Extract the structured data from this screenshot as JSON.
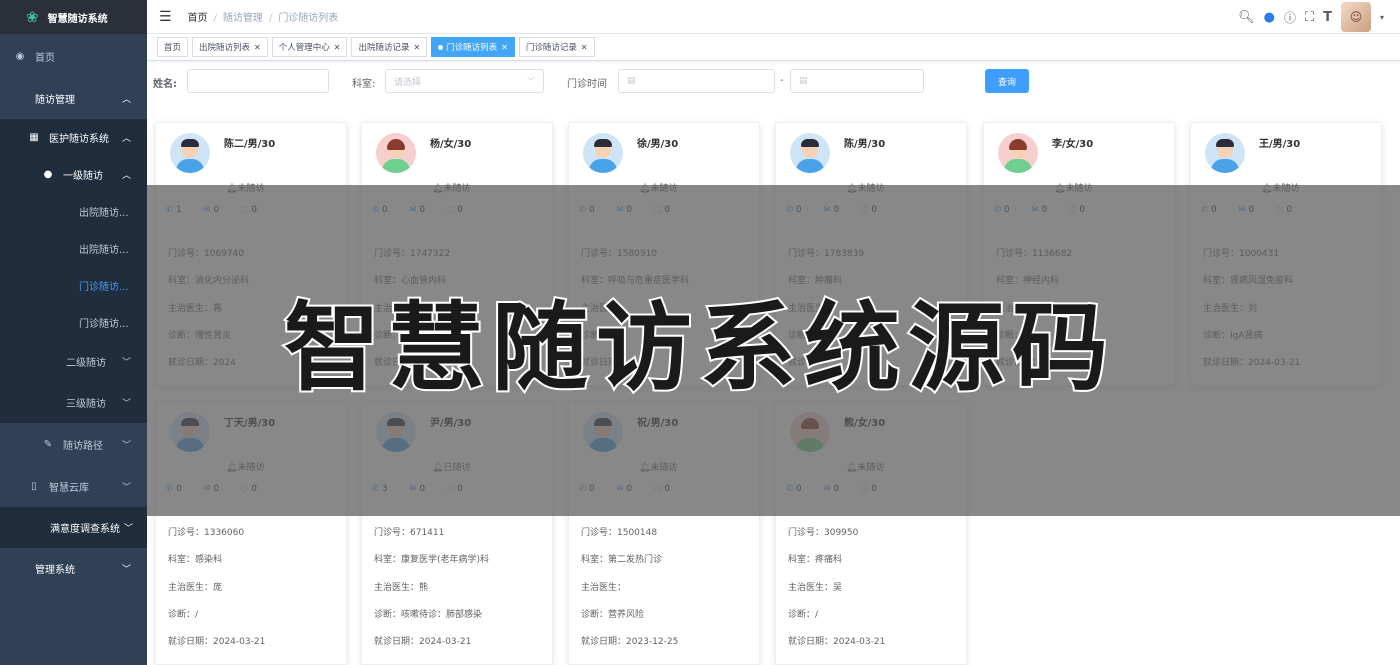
{
  "app": {
    "title": "智慧随访系统"
  },
  "sidebar": {
    "items": [
      {
        "label": "首页",
        "icon": "dashboard-icon"
      },
      {
        "label": "随访管理"
      },
      {
        "label": "医护随访系统",
        "icon": "grid-icon"
      },
      {
        "label": "一级随访",
        "icon": "user-icon"
      },
      {
        "label": "出院随访..."
      },
      {
        "label": "出院随访..."
      },
      {
        "label": "门诊随访..."
      },
      {
        "label": "门诊随访..."
      },
      {
        "label": "二级随访"
      },
      {
        "label": "三级随访"
      },
      {
        "label": "随访路径",
        "icon": "edit-icon"
      },
      {
        "label": "智慧云库",
        "icon": "book-icon"
      },
      {
        "label": "满意度调查系统"
      },
      {
        "label": "管理系统"
      }
    ]
  },
  "breadcrumb": [
    "首页",
    "随访管理",
    "门诊随访列表"
  ],
  "tags": [
    {
      "label": "首页",
      "closable": false,
      "active": false
    },
    {
      "label": "出院随访列表",
      "closable": true,
      "active": false
    },
    {
      "label": "个人管理中心",
      "closable": true,
      "active": false
    },
    {
      "label": "出院随访记录",
      "closable": true,
      "active": false
    },
    {
      "label": "门诊随访列表",
      "closable": true,
      "active": true
    },
    {
      "label": "门诊随访记录",
      "closable": true,
      "active": false
    }
  ],
  "search": {
    "name_label": "姓名:",
    "dept_label": "科室:",
    "dept_placeholder": "请选择",
    "time_label": "门诊时间",
    "range_sep": "-",
    "query_button": "查询"
  },
  "cards": [
    {
      "name": "陈二/男/30",
      "gender": "m",
      "status": "未随访",
      "counts": [
        "1",
        "0",
        "0"
      ],
      "outpatient_no": "门诊号：1069740",
      "dept": "科室：消化内分泌科",
      "doctor": "主治医生：蒋",
      "diagnosis": "诊断：慢性胃炎",
      "visit_date": "就诊日期：2024"
    },
    {
      "name": "杨/女/30",
      "gender": "f",
      "status": "未随访",
      "counts": [
        "0",
        "0",
        "0"
      ],
      "outpatient_no": "门诊号：1747322",
      "dept": "科室：心血管内科",
      "doctor": "主治医生：",
      "diagnosis": "诊断：",
      "visit_date": "就诊日期：2024-03-21"
    },
    {
      "name": "徐/男/30",
      "gender": "m",
      "status": "未随访",
      "counts": [
        "0",
        "0",
        "0"
      ],
      "outpatient_no": "门诊号：1580910",
      "dept": "科室：呼吸与危重症医学科",
      "doctor": "主治医生：",
      "diagnosis": "诊断：",
      "visit_date": "就诊日期："
    },
    {
      "name": "陈/男/30",
      "gender": "m",
      "status": "未随访",
      "counts": [
        "0",
        "0",
        "0"
      ],
      "outpatient_no": "门诊号：1783839",
      "dept": "科室：肿瘤科",
      "doctor": "主治医生：",
      "diagnosis": "诊断：",
      "visit_date": "就诊日期："
    },
    {
      "name": "李/女/30",
      "gender": "f",
      "status": "未随访",
      "counts": [
        "0",
        "0",
        "0"
      ],
      "outpatient_no": "门诊号：1136682",
      "dept": "科室：神经内科",
      "doctor": "主治医生：",
      "diagnosis": "诊断：",
      "visit_date": "就诊日期："
    },
    {
      "name": "王/男/30",
      "gender": "m",
      "status": "未随访",
      "counts": [
        "0",
        "0",
        "0"
      ],
      "outpatient_no": "门诊号：1000431",
      "dept": "科室：肾病风湿免疫科",
      "doctor": "主治医生：刘",
      "diagnosis": "诊断：IgA肾病",
      "visit_date": "就诊日期：2024-03-21"
    },
    {
      "name": "丁天/男/30",
      "gender": "m",
      "status": "未随访",
      "counts": [
        "0",
        "0",
        "0"
      ],
      "outpatient_no": "门诊号：1336060",
      "dept": "科室：感染科",
      "doctor": "主治医生：庞",
      "diagnosis": "诊断：/",
      "visit_date": "就诊日期：2024-03-21"
    },
    {
      "name": "尹/男/30",
      "gender": "m",
      "status": "已随访",
      "counts": [
        "3",
        "0",
        "0"
      ],
      "outpatient_no": "门诊号：671411",
      "dept": "科室：康复医学(老年病学)科",
      "doctor": "主治医生：熊",
      "diagnosis": "诊断：咳嗽待诊：肺部感染",
      "visit_date": "就诊日期：2024-03-21"
    },
    {
      "name": "祝/男/30",
      "gender": "m",
      "status": "未随访",
      "counts": [
        "0",
        "0",
        "0"
      ],
      "outpatient_no": "门诊号：1500148",
      "dept": "科室：第二发热门诊",
      "doctor": "主治医生：",
      "diagnosis": "诊断：营养风险",
      "visit_date": "就诊日期：2023-12-25"
    },
    {
      "name": "熊/女/30",
      "gender": "f",
      "status": "未随访",
      "counts": [
        "0",
        "0",
        "0"
      ],
      "outpatient_no": "门诊号：309950",
      "dept": "科室：疼痛科",
      "doctor": "主治医生：吴",
      "diagnosis": "诊断：/",
      "visit_date": "就诊日期：2024-03-21"
    }
  ],
  "banner": "智慧随访系统源码"
}
